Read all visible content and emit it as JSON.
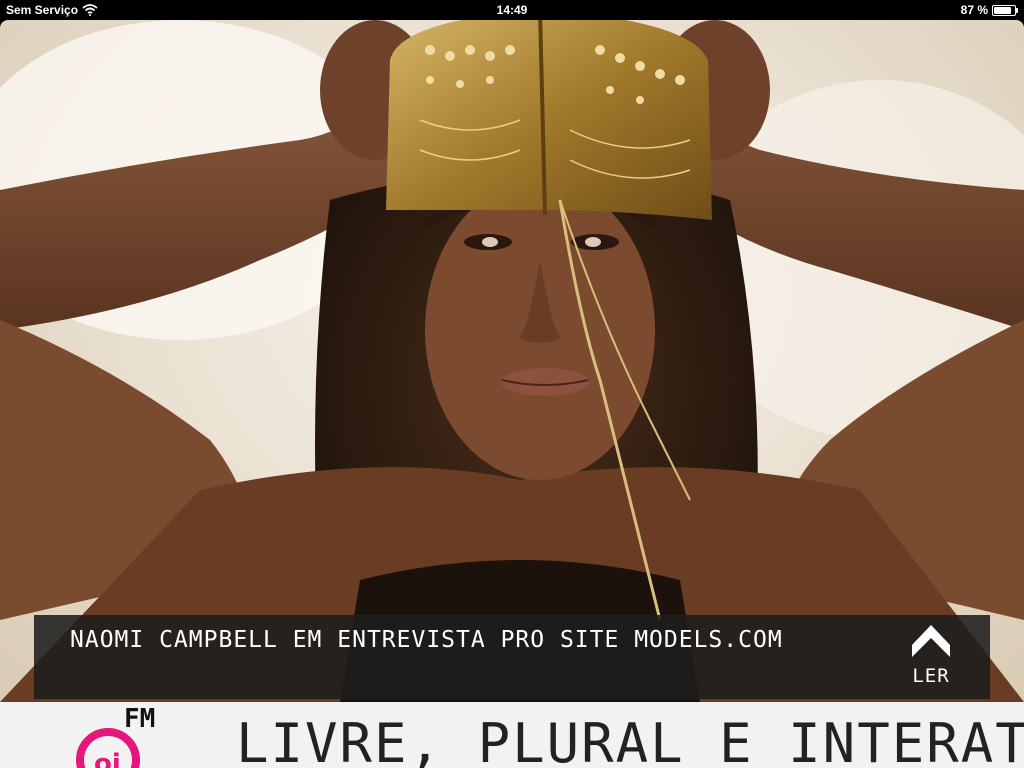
{
  "status_bar": {
    "carrier": "Sem Serviço",
    "time": "14:49",
    "battery_percent_text": "87 %",
    "battery_level": 0.87
  },
  "article": {
    "caption": "NAOMI CAMPBELL EM ENTREVISTA PRO SITE MODELS.COM",
    "read_label": "LER"
  },
  "ad": {
    "logo_text": "FM",
    "slogan": "LIVRE, PLURAL E INTERAT",
    "brand_color": "#e2187a"
  },
  "icons": {
    "wifi": "wifi-icon",
    "battery": "battery-icon",
    "read": "arrow-up-icon"
  }
}
